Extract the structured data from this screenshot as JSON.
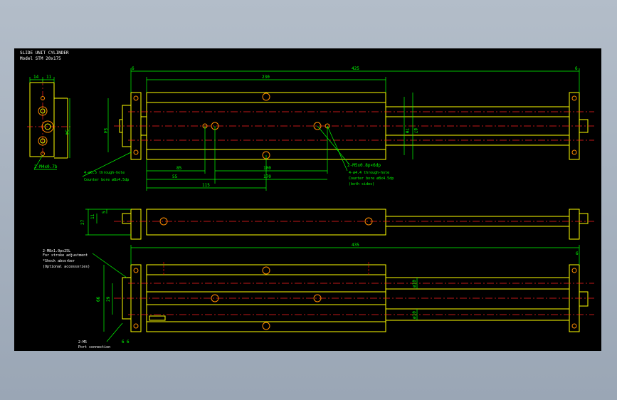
{
  "title_block": {
    "title": "SLIDE UNIT CYLINDER",
    "model": "Model  STM 20x175"
  },
  "colors": {
    "background": "#000000",
    "outline": "#ffff00",
    "centerline": "#ff2020",
    "dimension": "#00ff00",
    "hidden": "#ff0000",
    "circle": "#ff8c00",
    "note": "#ffffff"
  },
  "dims": {
    "d14": "14",
    "d11": "11",
    "d34": "34",
    "d6a": "6",
    "d6b": "6",
    "d230": "230",
    "d425": "425",
    "d54": "54",
    "d70": "70",
    "d87": "87",
    "d85": "85",
    "d55": "55",
    "d100": "100",
    "d170": "170",
    "d115": "115",
    "d27": "27",
    "d5": "5",
    "d11b": "11",
    "d435": "435",
    "d6c": "6",
    "d66": "66",
    "d29": "29",
    "d6d": "6",
    "d6e": "6",
    "phi10a": "ø10",
    "phi10b": "ø10"
  },
  "notes": {
    "m4": "2-M4x0.7b",
    "m5": "2-M5x0.8p×6dp",
    "thru1": "4-ø6.5 through-hole",
    "thru1b": "Counter bore ø8x4.5dp",
    "thru2": "4-ø4.4 through-hole",
    "thru2b": "Counter bore ø8x4.5dp",
    "thru2c": "(both sides)",
    "m8": "2-M8x1.0px25L",
    "m8b": "For stroke adjustment",
    "shock": "*Shock absorber",
    "shock_b": "(Optional accessories)",
    "port": "2-M5",
    "port_b": "Port connection"
  }
}
